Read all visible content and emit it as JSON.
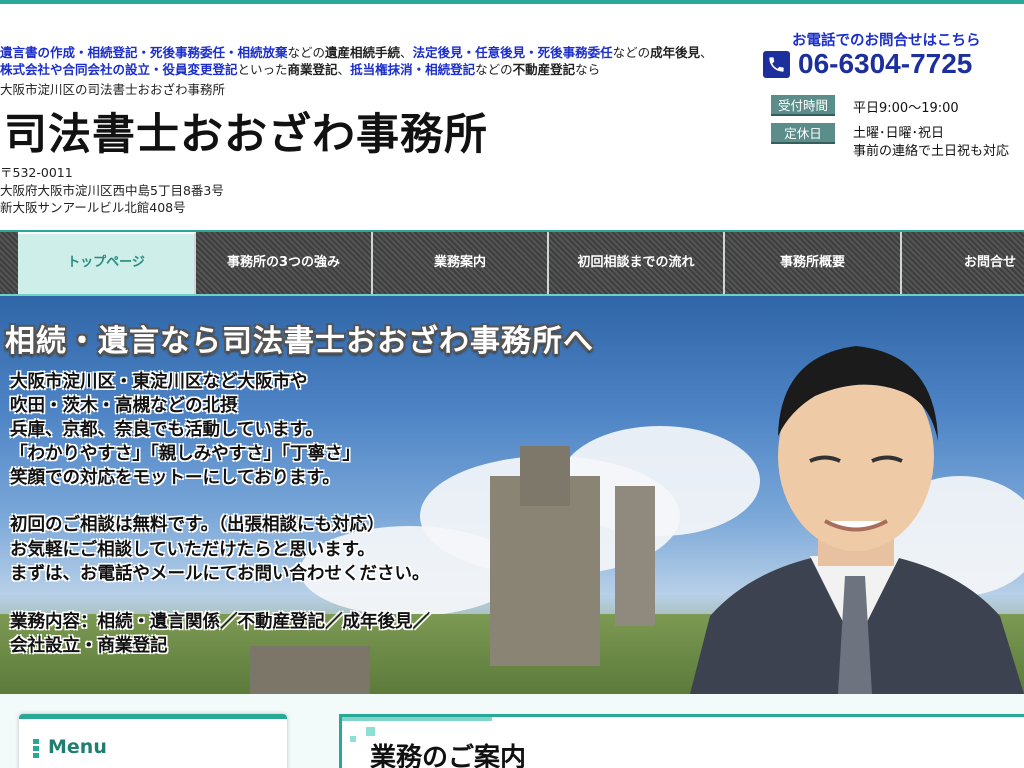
{
  "header": {
    "intro_line1": [
      {
        "text": "遺言書の作成・相続登記・死後事務委任・相続放棄",
        "style": "blue"
      },
      {
        "text": "などの",
        "style": "plain"
      },
      {
        "text": "遺産相続手続",
        "style": "bold"
      },
      {
        "text": "、",
        "style": "plain"
      },
      {
        "text": "法定後見・任意後見・死後事務委任",
        "style": "blue"
      },
      {
        "text": "などの",
        "style": "plain"
      },
      {
        "text": "成年後見",
        "style": "bold"
      },
      {
        "text": "、",
        "style": "plain"
      }
    ],
    "intro_line2": [
      {
        "text": "株式会社や合同会社の設立・役員変更登記",
        "style": "blue"
      },
      {
        "text": "といった",
        "style": "plain"
      },
      {
        "text": "商業登記",
        "style": "bold"
      },
      {
        "text": "、",
        "style": "plain"
      },
      {
        "text": "抵当権抹消・相続登記",
        "style": "blue"
      },
      {
        "text": "などの",
        "style": "plain"
      },
      {
        "text": "不動産登記",
        "style": "bold"
      },
      {
        "text": "なら",
        "style": "plain"
      }
    ],
    "tagline": "大阪市淀川区の司法書士おおざわ事務所",
    "title": "司法書士おおざわ事務所",
    "postal": "〒532-0011",
    "address1": "大阪府大阪市淀川区西中島5丁目8番3号",
    "address2": "新大阪サンアールビル北館408号",
    "phone_caption": "お電話でのお問合せはこちら",
    "phone": "06-6304-7725",
    "hours_label": "受付時間",
    "hours_value": "平日9:00〜19:00",
    "closed_label": "定休日",
    "closed_value1": "土曜･日曜･祝日",
    "closed_value2": "事前の連絡で土日祝も対応"
  },
  "nav": {
    "items": [
      {
        "label": "トップページ",
        "active": true
      },
      {
        "label": "事務所の3つの強み",
        "active": false
      },
      {
        "label": "業務案内",
        "active": false
      },
      {
        "label": "初回相談までの流れ",
        "active": false
      },
      {
        "label": "事務所概要",
        "active": false
      },
      {
        "label": "お問合せ",
        "active": false
      }
    ]
  },
  "hero": {
    "heading": "相続・遺言なら司法書士おおざわ事務所へ",
    "lines": [
      "大阪市淀川区・東淀川区など大阪市や",
      "吹田・茨木・高槻などの北摂",
      "兵庫、京都、奈良でも活動しています。",
      "「わかりやすさ」「親しみやすさ」「丁寧さ」",
      "笑顔での対応をモットーにしております。",
      "初回のご相談は無料です。（出張相談にも対応）",
      "お気軽にご相談していただけたらと思います。",
      "まずは、お電話やメールにてお問い合わせください。",
      "業務内容：相続・遺言関係／不動産登記／成年後見／",
      "会社設立・商業登記"
    ]
  },
  "sidebar": {
    "title": "Menu"
  },
  "main": {
    "section_title": "業務のご案内"
  },
  "colors": {
    "accent": "#2aa897",
    "link_blue": "#1c2fcc",
    "phone_blue": "#1c2f9c",
    "badge": "#5b8e8a"
  }
}
